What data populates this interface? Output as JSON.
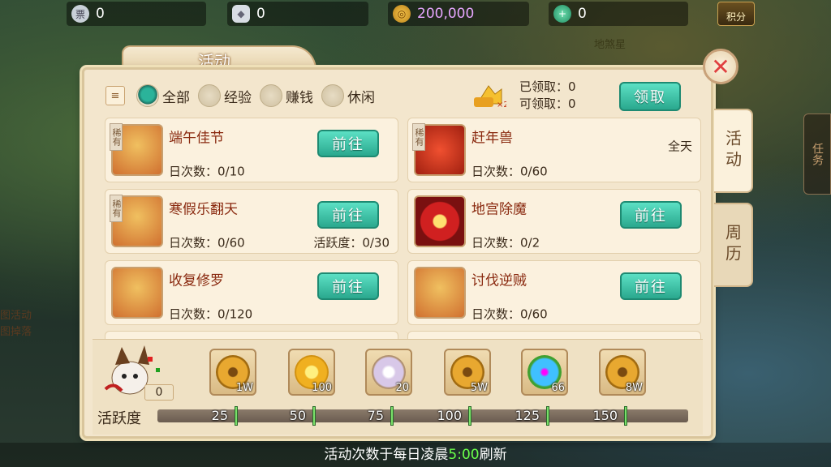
{
  "top": {
    "silver_ticket": "0",
    "ingot": "0",
    "gold": "200,000",
    "jade": "0",
    "score_label": "积分",
    "map_name": "地煞星"
  },
  "left_notes": [
    "图活动",
    "图掉落"
  ],
  "panel": {
    "title": "活动",
    "close": "✕"
  },
  "side_tabs": [
    "活动",
    "周历"
  ],
  "task_tab": "任务",
  "filters": [
    "全部",
    "经验",
    "赚钱",
    "休闲"
  ],
  "claim": {
    "claimed": "已领取：0",
    "claimable": "可领取：0",
    "button": "领取",
    "badge": "×2"
  },
  "rare_label": "稀有",
  "go_label": "前往",
  "activities": [
    {
      "name": "端午佳节",
      "count": "日次数：0/10",
      "extra": "",
      "rare": true,
      "go": true
    },
    {
      "name": "赶年兽",
      "count": "日次数：0/60",
      "extra": "全天",
      "rare": true,
      "go": false
    },
    {
      "name": "寒假乐翻天",
      "count": "日次数：0/60",
      "extra": "活跃度：0/30",
      "rare": true,
      "go": true
    },
    {
      "name": "地宫除魔",
      "count": "日次数：0/2",
      "extra": "",
      "rare": false,
      "go": true
    },
    {
      "name": "收复修罗",
      "count": "日次数：0/120",
      "extra": "",
      "rare": false,
      "go": true
    },
    {
      "name": "讨伐逆贼",
      "count": "日次数：0/60",
      "extra": "",
      "rare": false,
      "go": true
    }
  ],
  "activity_value": "0",
  "activity_label": "活跃度",
  "rewards": [
    {
      "icon": "coin-icon",
      "amount": "1W"
    },
    {
      "icon": "flower-gold-icon",
      "amount": "100"
    },
    {
      "icon": "crystal-shoe-icon",
      "amount": "20"
    },
    {
      "icon": "coin-icon",
      "amount": "5W"
    },
    {
      "icon": "orb-icon",
      "amount": "66"
    },
    {
      "icon": "coin-icon",
      "amount": "8W"
    }
  ],
  "milestones": [
    "25",
    "50",
    "75",
    "100",
    "125",
    "150"
  ],
  "footer": {
    "pre": "活动次数于每日凌晨",
    "time": "5:00",
    "post": "刷新"
  },
  "colors": {
    "accent": "#2aa88e",
    "milestone": "#7ae06a",
    "title_red": "#8a2a10"
  }
}
